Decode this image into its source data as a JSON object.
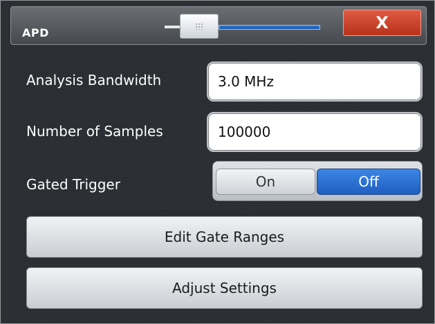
{
  "dialog": {
    "title": "APD",
    "close_label": "X"
  },
  "fields": [
    {
      "label": "Analysis Bandwidth",
      "value": "3.0 MHz"
    },
    {
      "label": "Number of Samples",
      "value": "100000"
    }
  ],
  "gated_trigger": {
    "label": "Gated Trigger",
    "on_label": "On",
    "off_label": "Off",
    "selected": "Off"
  },
  "buttons": {
    "edit_gate_ranges": "Edit Gate Ranges",
    "adjust_settings": "Adjust Settings"
  },
  "colors": {
    "accent": "#1f5fc0",
    "close": "#c84028"
  },
  "icons": [
    "slider-thumb-grip-icon",
    "close-icon"
  ]
}
